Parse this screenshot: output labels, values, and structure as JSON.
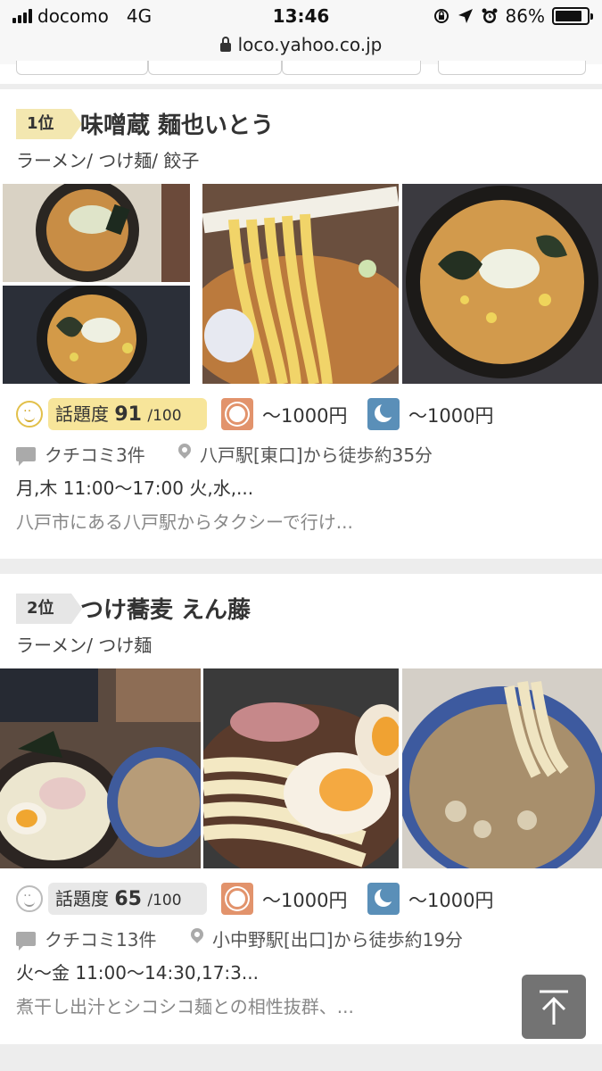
{
  "status_bar": {
    "carrier": "docomo",
    "network": "4G",
    "time": "13:46",
    "battery": "86%",
    "battery_level": 0.86
  },
  "url_bar": {
    "url": "loco.yahoo.co.jp"
  },
  "restaurants": [
    {
      "rank": "1位",
      "name": "味噌蔵 麺也いとう",
      "genre": "ラーメン/ つけ麺/ 餃子",
      "popularity_label": "話題度",
      "popularity_score": "91",
      "popularity_max": "/100",
      "lunch_price": "〜1000円",
      "dinner_price": "〜1000円",
      "reviews": "クチコミ3件",
      "access": "八戸駅[東口]から徒歩約35分",
      "hours": "月,木 11:00〜17:00 火,水,...",
      "description": "八戸市にある八戸駅からタクシーで行け..."
    },
    {
      "rank": "2位",
      "name": "つけ蕎麦 えん藤",
      "genre": "ラーメン/ つけ麺",
      "popularity_label": "話題度",
      "popularity_score": "65",
      "popularity_max": "/100",
      "lunch_price": "〜1000円",
      "dinner_price": "〜1000円",
      "reviews": "クチコミ13件",
      "access": "小中野駅[出口]から徒歩約19分",
      "hours": "火〜金 11:00〜14:30,17:3...",
      "description": "煮干し出汁とシコシコ麺との相性抜群、..."
    }
  ],
  "icons": {
    "popularity": "smiley-icon",
    "lunch": "sun-icon",
    "dinner": "moon-icon",
    "reviews": "speech-bubble-icon",
    "location": "location-pin-icon",
    "scroll_top": "scroll-to-top-icon"
  },
  "colors": {
    "rank1_badge": "#f3e7b0",
    "rank2_badge": "#e6e6e6",
    "popularity_high": "#f7e59a",
    "lunch_icon": "#e2936c",
    "dinner_icon": "#5a8fb8"
  }
}
